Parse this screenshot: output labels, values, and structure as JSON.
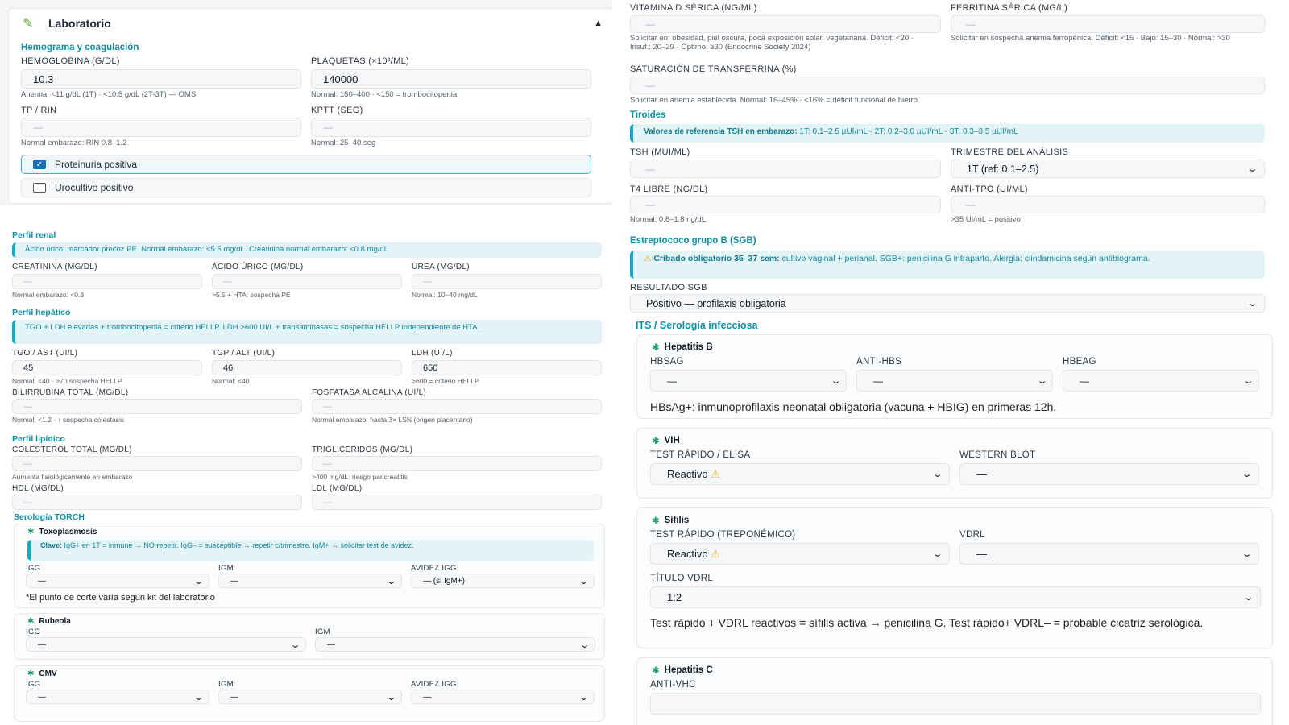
{
  "lab": {
    "header": "Laboratorio",
    "hemo_title": "Hemograma y coagulación",
    "hb_label": "HEMOGLOBINA (G/DL)",
    "hb_value": "10.3",
    "hb_hint": "Anemia: <11 g/dL (1T) · <10.5 g/dL (2T-3T) — OMS",
    "plq_label": "PLAQUETAS (×10³/ML)",
    "plq_value": "140000",
    "plq_hint": "Normal: 150–400 · <150 = trombocitopenia",
    "tp_label": "TP / RIN",
    "tp_value": "—",
    "tp_hint": "Normal embarazo: RIN 0.8–1.2",
    "kptt_label": "KPTT (SEG)",
    "kptt_value": "—",
    "kptt_hint": "Normal: 25–40 seg",
    "prot_label": "Proteinuria positiva",
    "uro_label": "Urocultivo positivo"
  },
  "renal": {
    "title": "Perfil renal",
    "info": "Ácido úrico: marcador precoz PE. Normal embarazo: <5.5 mg/dL. Creatinina normal embarazo: <0.8 mg/dL.",
    "crea_label": "CREATININA (MG/DL)",
    "crea_value": "—",
    "crea_hint": "Normal embarazo: <0.8",
    "acu_label": "ÁCIDO ÚRICO (MG/DL)",
    "acu_value": "—",
    "acu_hint": ">5.5 + HTA: sospecha PE",
    "urea_label": "UREA (MG/DL)",
    "urea_value": "—",
    "urea_hint": "Normal: 10–40 mg/dL"
  },
  "hepatic": {
    "title": "Perfil hepático",
    "info": "TGO + LDH elevadas + trombocitopenia = criterio HELLP. LDH >600 UI/L + transaminasas = sospecha HELLP independiente de HTA.",
    "tgo_label": "TGO / AST (UI/L)",
    "tgo_value": "45",
    "tgo_hint": "Normal: <40 · >70 sospecha HELLP",
    "tgp_label": "TGP / ALT (UI/L)",
    "tgp_value": "46",
    "tgp_hint": "Normal: <40",
    "ldh_label": "LDH (UI/L)",
    "ldh_value": "650",
    "ldh_hint": ">600 = criterio HELLP",
    "bili_label": "BILIRRUBINA TOTAL (MG/DL)",
    "bili_value": "—",
    "bili_hint": "Normal: <1.2 · ↑ sospecha colestasis",
    "fa_label": "FOSFATASA ALCALINA (UI/L)",
    "fa_value": "—",
    "fa_hint": "Normal embarazo: hasta 3× LSN (origen placentario)"
  },
  "lipid": {
    "title": "Perfil lipídico",
    "col_label": "COLESTEROL TOTAL (MG/DL)",
    "col_value": "—",
    "col_hint": "Aumenta fisiológicamente en embarazo",
    "tg_label": "TRIGLICÉRIDOS (MG/DL)",
    "tg_value": "—",
    "tg_hint": ">400 mg/dL: riesgo pancreatitis",
    "hdl_label": "HDL (MG/DL)",
    "hdl_value": "—",
    "ldl_label": "LDL (MG/DL)",
    "ldl_value": "—"
  },
  "torch": {
    "title": "Serología TORCH",
    "toxo_title": "Toxoplasmosis",
    "toxo_info_bold": "Clave:",
    "toxo_info": " IgG+ en 1T = inmune → NO repetir. IgG– = susceptible → repetir c/trimestre. IgM+ → solicitar test de avidez.",
    "igg_label": "IGG",
    "igm_label": "IGM",
    "avidez_label": "AVIDEZ IGG",
    "dash": "—",
    "avidez_value": "— (si IgM+)",
    "toxo_note": "*El punto de corte varía según kit del laboratorio",
    "rubeola_title": "Rubeola",
    "cmv_title": "CMV"
  },
  "tr": {
    "vitd_label": "VITAMINA D SÉRICA (NG/ML)",
    "vitd_value": "—",
    "vitd_hint": "Solicitar en: obesidad, piel oscura, poca exposición solar, vegetariana. Déficit: <20 · Insuf.: 20–29 · Óptimo: ≥30 (Endocrine Society 2024)",
    "ferr_label": "FERRITINA SÉRICA (MG/L)",
    "ferr_value": "—",
    "ferr_hint": "Solicitar en sospecha anemia ferropénica. Déficit: <15 · Bajo: 15–30 · Normal: >30",
    "sat_label": "SATURACIÓN DE TRANSFERRINA (%)",
    "sat_value": "—",
    "sat_hint": "Solicitar en anemia establecida. Normal: 16–45% · <16% = déficit funcional de hierro",
    "tir_title": "Tiroides",
    "tsh_info_bold": "Valores de referencia TSH en embarazo:",
    "tsh_info": " 1T: 0.1–2.5 µUI/mL · 2T: 0.2–3.0 µUI/mL · 3T: 0.3–3.5 µUI/mL",
    "tsh_label": "TSH (MUI/ML)",
    "tsh_value": "—",
    "trim_label": "TRIMESTRE DEL ANÁLISIS",
    "trim_value": "1T (ref: 0.1–2.5)",
    "t4_label": "T4 LIBRE (NG/DL)",
    "t4_value": "—",
    "t4_hint": "Normal: 0.8–1.8 ng/dL",
    "tpo_label": "ANTI-TPO (UI/ML)",
    "tpo_value": "—",
    "tpo_hint": ">35 UI/mL = positivo",
    "sgb_title": "Estreptococo grupo B (SGB)",
    "sgb_info_bold": "Cribado obligatorio 35–37 sem:",
    "sgb_info": " cultivo vaginal + perianal. SGB+: penicilina G intraparto. Alergia: clindamicina según antibiograma.",
    "sgb_result_label": "RESULTADO SGB",
    "sgb_result_value": "Positivo — profilaxis obligatoria"
  },
  "its": {
    "title": "ITS / Serología infecciosa",
    "hepb_title": "Hepatitis B",
    "hbsag_label": "HBSAG",
    "antihbs_label": "ANTI-HBS",
    "hbeag_label": "HBEAG",
    "dash": "—",
    "hepb_note": "HBsAg+: inmunoprofilaxis neonatal obligatoria (vacuna + HBIG) en primeras 12h.",
    "vih_title": "VIH",
    "vih_test_label": "TEST RÁPIDO / ELISA",
    "vih_test_value": "Reactivo",
    "wb_label": "WESTERN BLOT",
    "sif_title": "Sífilis",
    "sif_test_label": "TEST RÁPIDO (TREPONÉMICO)",
    "sif_test_value": "Reactivo",
    "vdrl_label": "VDRL",
    "titulo_label": "TÍTULO VDRL",
    "titulo_value": "1:2",
    "sif_note": "Test rápido + VDRL reactivos = sífilis activa → penicilina G. Test rápido+ VDRL– = probable cicatriz serológica.",
    "hepc_title": "Hepatitis C",
    "antivhc_label": "ANTI-VHC"
  },
  "colors": {
    "accent": "#0e8fa6",
    "info_bg": "#e3f4f7",
    "check": "#1a6fb0",
    "warn": "#f2b01e"
  }
}
